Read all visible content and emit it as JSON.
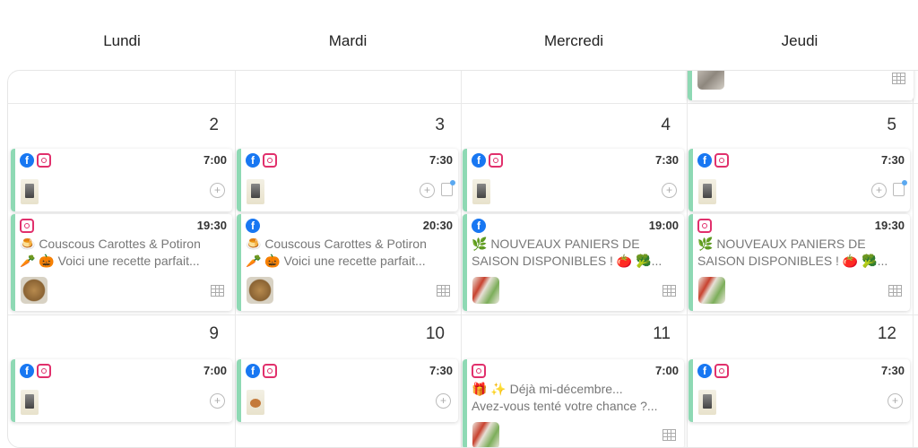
{
  "days": [
    "Lundi",
    "Mardi",
    "Mercredi",
    "Jeudi"
  ],
  "week1": {
    "numbers": [
      "2",
      "3",
      "4",
      "5"
    ]
  },
  "week2": {
    "numbers": [
      "9",
      "10",
      "11",
      "12"
    ]
  },
  "cards": {
    "w1_lundi_a": {
      "time": "7:00"
    },
    "w1_mardi_a": {
      "time": "7:30"
    },
    "w1_mercredi_a": {
      "time": "7:30"
    },
    "w1_jeudi_a": {
      "time": "7:30"
    },
    "w1_lundi_b": {
      "time": "19:30",
      "line1": "🍮 Couscous Carottes & Potiron",
      "line2": "🥕 🎃 Voici une recette parfait..."
    },
    "w1_mardi_b": {
      "time": "20:30",
      "line1": "🍮 Couscous Carottes & Potiron",
      "line2": "🥕 🎃 Voici une recette parfait..."
    },
    "w1_mercredi_b": {
      "time": "19:00",
      "line1": "🌿 NOUVEAUX PANIERS DE",
      "line2": "SAISON DISPONIBLES ! 🍅 🥦..."
    },
    "w1_jeudi_b": {
      "time": "19:30",
      "line1": "🌿 NOUVEAUX PANIERS DE",
      "line2": "SAISON DISPONIBLES ! 🍅 🥦..."
    },
    "w2_lundi_a": {
      "time": "7:00"
    },
    "w2_mardi_a": {
      "time": "7:30"
    },
    "w2_mercredi_a": {
      "time": "7:00",
      "line1": "🎁 ✨ Déjà mi-décembre...",
      "line2": "Avez-vous tenté votre chance ?..."
    },
    "w2_jeudi_a": {
      "time": "7:30"
    }
  },
  "icons": {
    "facebook_color": "#1877f2",
    "instagram_color": "#e1306c",
    "accent_color": "#8ed9b4",
    "facebook_glyph": "f",
    "plus_glyph": "+"
  }
}
